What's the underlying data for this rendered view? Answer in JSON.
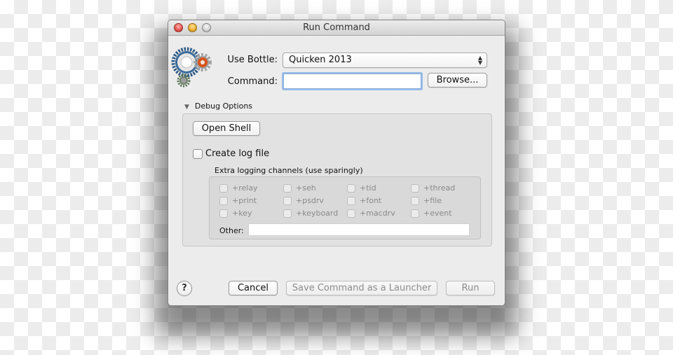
{
  "window": {
    "title": "Run Command",
    "traffic_lights": [
      "close",
      "minimize",
      "zoom"
    ]
  },
  "app_icon": "gears-icon",
  "form": {
    "use_bottle_label": "Use Bottle:",
    "use_bottle_value": "Quicken 2013",
    "command_label": "Command:",
    "command_value": "",
    "browse_label": "Browse..."
  },
  "debug": {
    "disclosure_label": "Debug Options",
    "expanded": true,
    "open_shell_label": "Open Shell",
    "create_log_label": "Create log file",
    "create_log_checked": false,
    "channels_title": "Extra logging channels (use sparingly)",
    "channels": [
      {
        "label": "+relay",
        "checked": false
      },
      {
        "label": "+seh",
        "checked": false
      },
      {
        "label": "+tid",
        "checked": false
      },
      {
        "label": "+thread",
        "checked": false
      },
      {
        "label": "+print",
        "checked": false
      },
      {
        "label": "+psdrv",
        "checked": false
      },
      {
        "label": "+font",
        "checked": false
      },
      {
        "label": "+file",
        "checked": false
      },
      {
        "label": "+key",
        "checked": false
      },
      {
        "label": "+keyboard",
        "checked": false
      },
      {
        "label": "+macdrv",
        "checked": false
      },
      {
        "label": "+event",
        "checked": false
      }
    ],
    "other_label": "Other:",
    "other_value": ""
  },
  "footer": {
    "help_label": "?",
    "cancel_label": "Cancel",
    "save_launcher_label": "Save Command as a Launcher",
    "run_label": "Run"
  }
}
